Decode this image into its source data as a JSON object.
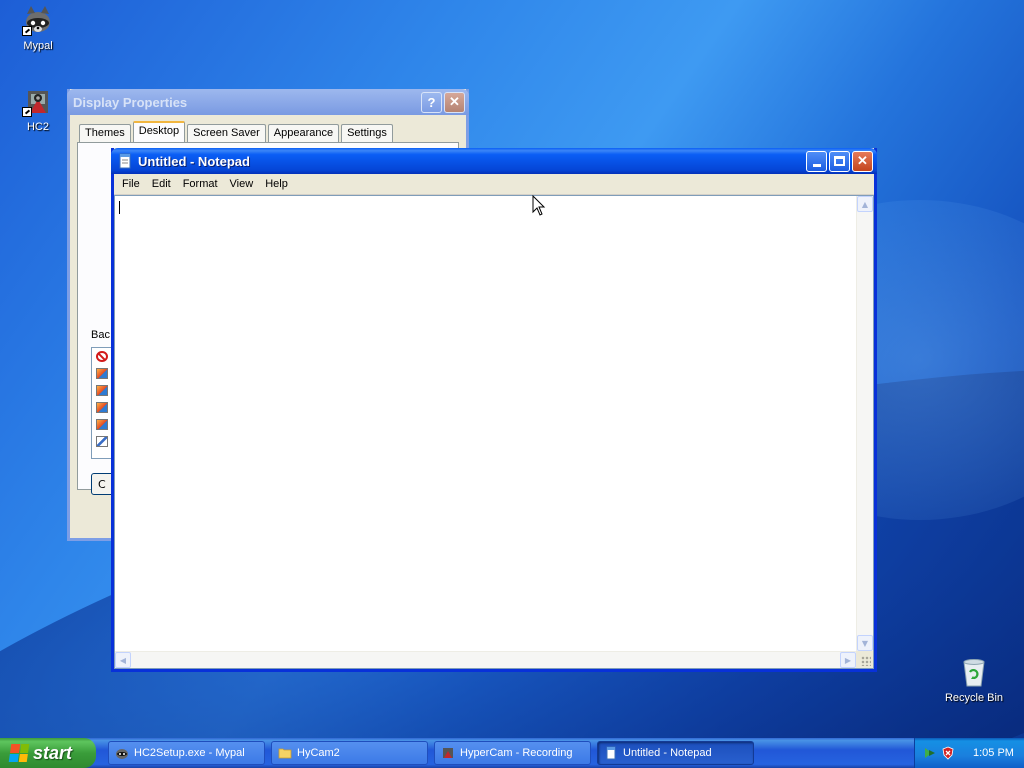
{
  "desktop": {
    "icons": [
      {
        "label": "Mypal"
      },
      {
        "label": "HC2"
      },
      {
        "label": "Recycle Bin"
      }
    ]
  },
  "display_properties": {
    "title": "Display Properties",
    "tabs": [
      "Themes",
      "Desktop",
      "Screen Saver",
      "Appearance",
      "Settings"
    ],
    "selected_tab": "Desktop",
    "background_label": "Bac",
    "button_stub_label": "C"
  },
  "notepad": {
    "title": "Untitled - Notepad",
    "menu": [
      "File",
      "Edit",
      "Format",
      "View",
      "Help"
    ],
    "content": ""
  },
  "taskbar": {
    "start_label": "start",
    "tasks": [
      {
        "label": "HC2Setup.exe - Mypal",
        "active": false
      },
      {
        "label": "HyCam2",
        "active": false
      },
      {
        "label": "HyperCam - Recording",
        "active": false
      },
      {
        "label": "Untitled - Notepad",
        "active": true
      }
    ],
    "clock": "1:05 PM"
  }
}
